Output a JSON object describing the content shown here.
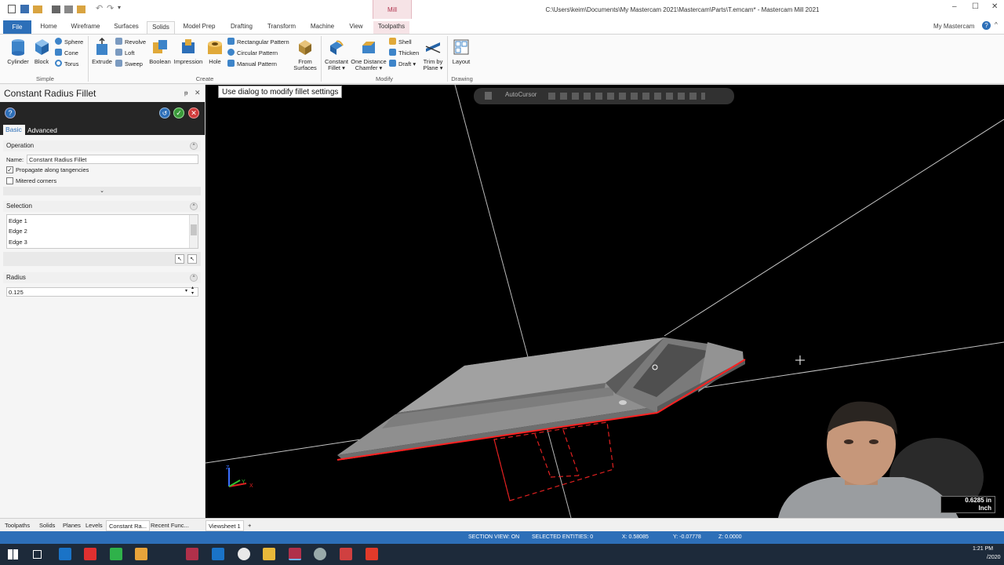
{
  "window": {
    "title": "C:\\Users\\keim\\Documents\\My Mastercam 2021\\Mastercam\\Parts\\T.emcam* - Mastercam Mill 2021",
    "context_tab": "Mill",
    "account": "My Mastercam"
  },
  "ribbon_tabs": [
    "File",
    "Home",
    "Wireframe",
    "Surfaces",
    "Solids",
    "Model Prep",
    "Drafting",
    "Transform",
    "Machine",
    "View",
    "Toolpaths"
  ],
  "ribbon": {
    "simple": {
      "label": "Simple",
      "cylinder": "Cylinder",
      "block": "Block",
      "sphere": "Sphere",
      "cone": "Cone",
      "torus": "Torus"
    },
    "create": {
      "label": "Create",
      "extrude": "Extrude",
      "revolve": "Revolve",
      "loft": "Loft",
      "sweep": "Sweep",
      "boolean": "Boolean",
      "impression": "Impression",
      "hole": "Hole",
      "rect_pattern": "Rectangular Pattern",
      "circ_pattern": "Circular Pattern",
      "manual_pattern": "Manual Pattern",
      "from_surfaces_1": "From",
      "from_surfaces_2": "Surfaces"
    },
    "modify": {
      "label": "Modify",
      "const_fillet_1": "Constant",
      "const_fillet_2": "Fillet ▾",
      "one_dist_1": "One Distance",
      "one_dist_2": "Chamfer ▾",
      "shell": "Shell",
      "thicken": "Thicken",
      "draft": "Draft ▾",
      "trim_1": "Trim by",
      "trim_2": "Plane ▾"
    },
    "drawing": {
      "label": "Drawing",
      "layout": "Layout"
    }
  },
  "panel": {
    "title": "Constant Radius Fillet",
    "tabs": {
      "basic": "Basic",
      "advanced": "Advanced"
    },
    "operation": {
      "header": "Operation",
      "name_label": "Name:",
      "name_value": "Constant Radius Fillet",
      "propagate": "Propagate along tangencies",
      "propagate_checked": true,
      "mitered": "Mitered corners",
      "mitered_checked": false
    },
    "selection": {
      "header": "Selection",
      "items": [
        "Edge 1",
        "Edge 2",
        "Edge 3"
      ]
    },
    "radius": {
      "header": "Radius",
      "value": "0.125"
    }
  },
  "viewport": {
    "prompt": "Use dialog to modify fillet settings",
    "autocursor": "AutoCursor",
    "scale_value": "0.6285 in",
    "scale_unit": "Inch",
    "axes": {
      "z": "Z",
      "y": "Y",
      "x": "X"
    }
  },
  "bottom_tabs": [
    "Toolpaths",
    "Solids",
    "Planes",
    "Levels",
    "Constant Ra...",
    "Recent Func..."
  ],
  "viewsheet": {
    "tab": "Viewsheet 1",
    "add": "+"
  },
  "status": {
    "section_view": "SECTION VIEW: ON",
    "selected": "SELECTED ENTITIES: 0",
    "x": "X:   0.58085",
    "y": "Y:   -0.07778",
    "z": "Z:   0.0000",
    "clock": "1:21 PM",
    "date": "/2020"
  },
  "colors": {
    "accent": "#2d6fb8",
    "viewport_bg": "#000000",
    "part_gray": "#8f8f8f",
    "edge_red": "#ff2020"
  }
}
